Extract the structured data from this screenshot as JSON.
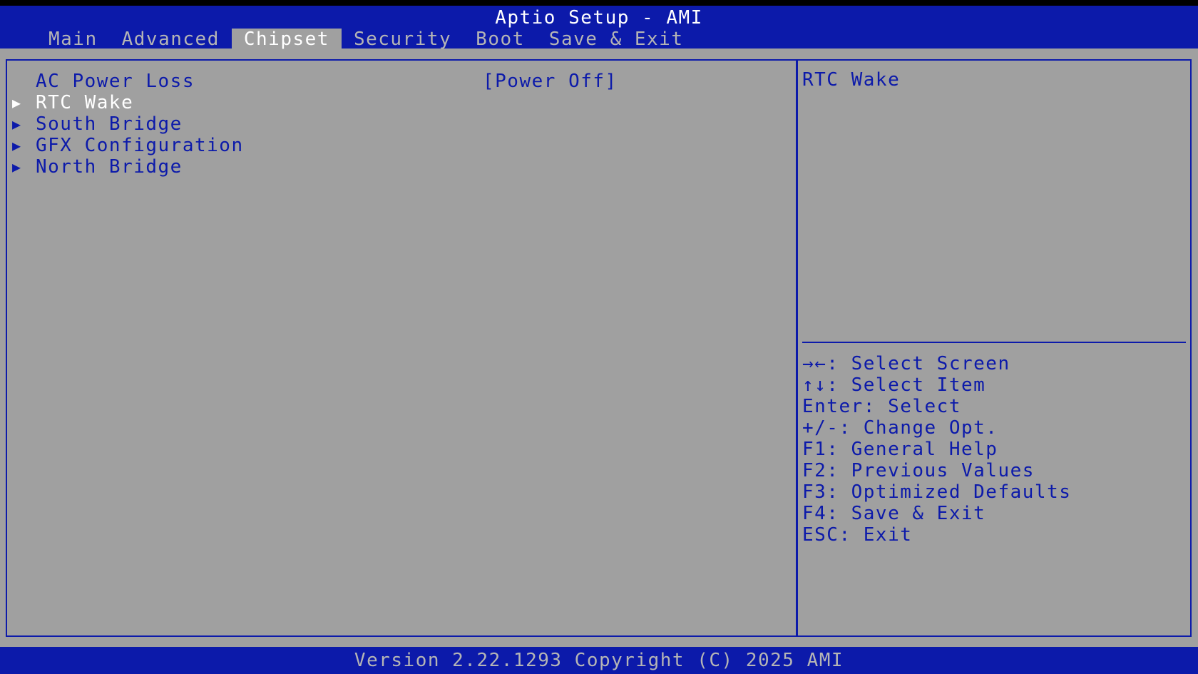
{
  "header": {
    "title": "Aptio Setup - AMI",
    "tabs": [
      {
        "label": "Main"
      },
      {
        "label": "Advanced"
      },
      {
        "label": "Chipset"
      },
      {
        "label": "Security"
      },
      {
        "label": "Boot"
      },
      {
        "label": "Save & Exit"
      }
    ],
    "active_tab": "Chipset"
  },
  "main": {
    "items": [
      {
        "label": "AC Power Loss",
        "value": "[Power Off]",
        "submenu": false
      },
      {
        "label": "RTC Wake",
        "submenu": true,
        "selected": true
      },
      {
        "label": "South Bridge",
        "submenu": true
      },
      {
        "label": "GFX Configuration",
        "submenu": true
      },
      {
        "label": "North Bridge",
        "submenu": true
      }
    ],
    "submenu_icon": "right-triangle-icon",
    "arrow_glyph": "▶"
  },
  "help": {
    "text": "RTC Wake",
    "keys": [
      "→←: Select Screen",
      "↑↓: Select Item",
      "Enter: Select",
      "+/-: Change Opt.",
      "F1: General Help",
      "F2: Previous Values",
      "F3: Optimized Defaults",
      "F4: Save & Exit",
      "ESC: Exit"
    ]
  },
  "footer": {
    "text": "Version 2.22.1293 Copyright (C) 2025 AMI"
  },
  "colors": {
    "accent_blue": "#0c1aaa",
    "background_gray": "#a0a0a0",
    "selected_white": "#ffffff",
    "inactive_tab": "#b5b5b5"
  }
}
